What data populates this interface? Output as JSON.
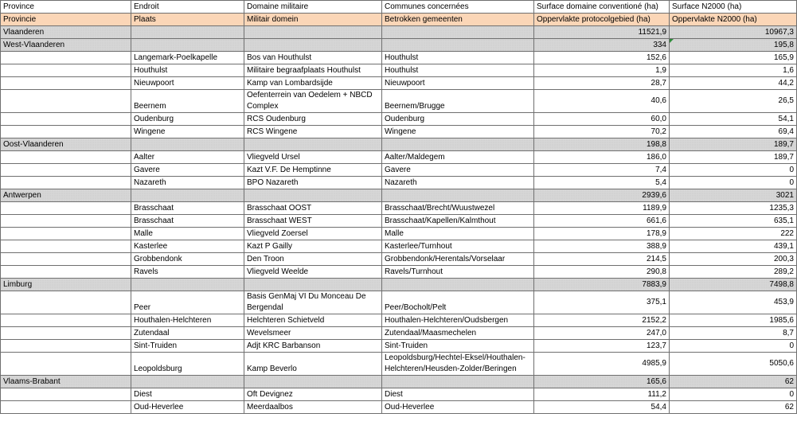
{
  "header_fr": [
    "Province",
    "Endroit",
    "Domaine militaire",
    "Communes concernées",
    "Surface domaine conventioné (ha)",
    "Surface N2000 (ha)"
  ],
  "header_nl": [
    "Provincie",
    "Plaats",
    "Militair domein",
    "Betrokken gemeenten",
    "Oppervlakte protocolgebied (ha)",
    "Oppervlakte N2000 (ha)"
  ],
  "rows": [
    {
      "type": "region",
      "province": "Vlaanderen",
      "surface": "11521,9",
      "n2000": "10967,3"
    },
    {
      "type": "region",
      "province": "West-Vlaanderen",
      "surface": "334",
      "n2000": "195,8",
      "comment": true
    },
    {
      "type": "item",
      "place": "Langemark-Poelkapelle",
      "domain": "Bos van Houthulst",
      "municipalities": "Houthulst",
      "surface": "152,6",
      "n2000": "165,9"
    },
    {
      "type": "item",
      "place": "Houthulst",
      "domain": "Militaire begraafplaats Houthulst",
      "municipalities": "Houthulst",
      "surface": "1,9",
      "n2000": "1,6"
    },
    {
      "type": "item",
      "place": "Nieuwpoort",
      "domain": "Kamp van Lombardsijde",
      "municipalities": "Nieuwpoort",
      "surface": "28,7",
      "n2000": "44,2"
    },
    {
      "type": "item",
      "place": "Beernem",
      "domain": "Oefenterrein van Oedelem + NBCD Complex",
      "municipalities": "Beernem/Brugge",
      "surface": "40,6",
      "n2000": "26,5"
    },
    {
      "type": "item",
      "place": "Oudenburg",
      "domain": "RCS Oudenburg",
      "municipalities": "Oudenburg",
      "surface": "60,0",
      "n2000": "54,1"
    },
    {
      "type": "item",
      "place": "Wingene",
      "domain": "RCS Wingene",
      "municipalities": "Wingene",
      "surface": "70,2",
      "n2000": "69,4"
    },
    {
      "type": "region",
      "province": "Oost-Vlaanderen",
      "surface": "198,8",
      "n2000": "189,7"
    },
    {
      "type": "item",
      "place": "Aalter",
      "domain": "Vliegveld Ursel",
      "municipalities": "Aalter/Maldegem",
      "surface": "186,0",
      "n2000": "189,7"
    },
    {
      "type": "item",
      "place": "Gavere",
      "domain": "Kazt V.F. De Hemptinne",
      "municipalities": "Gavere",
      "surface": "7,4",
      "n2000": "0"
    },
    {
      "type": "item",
      "place": "Nazareth",
      "domain": "BPO Nazareth",
      "municipalities": "Nazareth",
      "surface": "5,4",
      "n2000": "0"
    },
    {
      "type": "region",
      "province": "Antwerpen",
      "surface": "2939,6",
      "n2000": "3021"
    },
    {
      "type": "item",
      "place": "Brasschaat",
      "domain": "Brasschaat OOST",
      "municipalities": "Brasschaat/Brecht/Wuustwezel",
      "surface": "1189,9",
      "n2000": "1235,3"
    },
    {
      "type": "item",
      "place": "Brasschaat",
      "domain": "Brasschaat WEST",
      "municipalities": "Brasschaat/Kapellen/Kalmthout",
      "surface": "661,6",
      "n2000": "635,1"
    },
    {
      "type": "item",
      "place": "Malle",
      "domain": "Vliegveld Zoersel",
      "municipalities": "Malle",
      "surface": "178,9",
      "n2000": "222"
    },
    {
      "type": "item",
      "place": "Kasterlee",
      "domain": "Kazt P Gailly",
      "municipalities": "Kasterlee/Turnhout",
      "surface": "388,9",
      "n2000": "439,1"
    },
    {
      "type": "item",
      "place": "Grobbendonk",
      "domain": "Den Troon",
      "municipalities": "Grobbendonk/Herentals/Vorselaar",
      "surface": "214,5",
      "n2000": "200,3"
    },
    {
      "type": "item",
      "place": "Ravels",
      "domain": "Vliegveld Weelde",
      "municipalities": "Ravels/Turnhout",
      "surface": "290,8",
      "n2000": "289,2"
    },
    {
      "type": "region",
      "province": "Limburg",
      "surface": "7883,9",
      "n2000": "7498,8"
    },
    {
      "type": "item",
      "place": "Peer",
      "domain": "Basis GenMaj VI Du Monceau De Bergendal",
      "municipalities": "Peer/Bocholt/Pelt",
      "surface": "375,1",
      "n2000": "453,9"
    },
    {
      "type": "item",
      "place": "Houthalen-Helchteren",
      "domain": "Helchteren Schietveld",
      "municipalities": "Houthalen-Helchteren/Oudsbergen",
      "surface": "2152,2",
      "n2000": "1985,6"
    },
    {
      "type": "item",
      "place": "Zutendaal",
      "domain": "Wevelsmeer",
      "municipalities": "Zutendaal/Maasmechelen",
      "surface": "247,0",
      "n2000": "8,7"
    },
    {
      "type": "item",
      "place": "Sint-Truiden",
      "domain": "Adjt KRC Barbanson",
      "municipalities": "Sint-Truiden",
      "surface": "123,7",
      "n2000": "0"
    },
    {
      "type": "item",
      "place": "Leopoldsburg",
      "domain": "Kamp Beverlo",
      "municipalities": "Leopoldsburg/Hechtel-Eksel/Houthalen-Helchteren/Heusden-Zolder/Beringen",
      "surface": "4985,9",
      "n2000": "5050,6"
    },
    {
      "type": "region",
      "province": "Vlaams-Brabant",
      "surface": "165,6",
      "n2000": "62"
    },
    {
      "type": "item",
      "place": "Diest",
      "domain": "Oft Devignez",
      "municipalities": "Diest",
      "surface": "111,2",
      "n2000": "0"
    },
    {
      "type": "item",
      "place": "Oud-Heverlee",
      "domain": "Meerdaalbos",
      "municipalities": "Oud-Heverlee",
      "surface": "54,4",
      "n2000": "62"
    }
  ]
}
